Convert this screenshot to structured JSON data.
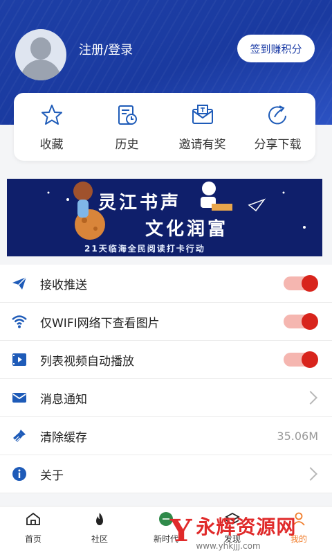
{
  "header": {
    "login_label": "注册/登录",
    "checkin_label": "签到赚积分"
  },
  "quick_actions": [
    {
      "icon": "star-icon",
      "label": "收藏"
    },
    {
      "icon": "history-icon",
      "label": "历史"
    },
    {
      "icon": "invite-envelope-icon",
      "label": "邀请有奖"
    },
    {
      "icon": "share-icon",
      "label": "分享下载"
    }
  ],
  "banner": {
    "line1": "灵江书声",
    "line2": "文化润富",
    "line3": "21天临海全民阅读打卡行动"
  },
  "settings": [
    {
      "icon": "send-icon",
      "label": "接收推送",
      "type": "toggle",
      "on": true
    },
    {
      "icon": "wifi-icon",
      "label": "仅WIFI网络下查看图片",
      "type": "toggle",
      "on": true
    },
    {
      "icon": "video-icon",
      "label": "列表视频自动播放",
      "type": "toggle",
      "on": true
    },
    {
      "icon": "mail-icon",
      "label": "消息通知",
      "type": "link"
    },
    {
      "icon": "broom-icon",
      "label": "清除缓存",
      "type": "value",
      "value": "35.06M"
    },
    {
      "icon": "info-icon",
      "label": "关于",
      "type": "link"
    }
  ],
  "tabbar": [
    {
      "icon": "home-icon",
      "label": "首页"
    },
    {
      "icon": "community-icon",
      "label": "社区"
    },
    {
      "icon": "news-icon",
      "label": "新时代"
    },
    {
      "icon": "discover-icon",
      "label": "发现"
    },
    {
      "icon": "profile-icon",
      "label": "我的"
    }
  ],
  "watermark": {
    "cn": "永辉资源网",
    "url": "www.yhkjjj.com"
  },
  "colors": {
    "header_blue": "#1d3fa6",
    "accent_red": "#d8241c",
    "icon_blue": "#1e5bb8"
  }
}
